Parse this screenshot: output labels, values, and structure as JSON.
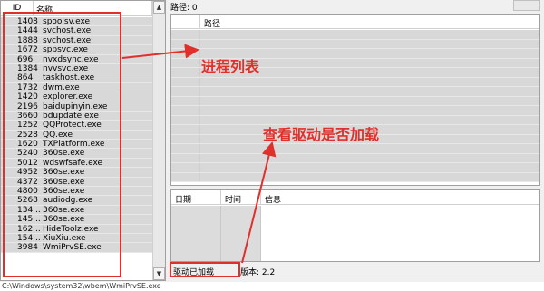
{
  "process_list": {
    "headers": {
      "pid": "ID",
      "name": "名称"
    },
    "rows": [
      {
        "pid": "1408",
        "name": "spoolsv.exe"
      },
      {
        "pid": "1444",
        "name": "svchost.exe"
      },
      {
        "pid": "1888",
        "name": "svchost.exe"
      },
      {
        "pid": "1672",
        "name": "sppsvc.exe"
      },
      {
        "pid": "696",
        "name": "nvxdsync.exe"
      },
      {
        "pid": "1384",
        "name": "nvvsvc.exe"
      },
      {
        "pid": "864",
        "name": "taskhost.exe"
      },
      {
        "pid": "1732",
        "name": "dwm.exe"
      },
      {
        "pid": "1420",
        "name": "explorer.exe"
      },
      {
        "pid": "2196",
        "name": "baidupinyin.exe"
      },
      {
        "pid": "3660",
        "name": "bdupdate.exe"
      },
      {
        "pid": "1252",
        "name": "QQProtect.exe"
      },
      {
        "pid": "2528",
        "name": "QQ.exe"
      },
      {
        "pid": "1620",
        "name": "TXPlatform.exe"
      },
      {
        "pid": "5240",
        "name": "360se.exe"
      },
      {
        "pid": "5012",
        "name": "wdswfsafe.exe"
      },
      {
        "pid": "4952",
        "name": "360se.exe"
      },
      {
        "pid": "4372",
        "name": "360se.exe"
      },
      {
        "pid": "4800",
        "name": "360se.exe"
      },
      {
        "pid": "5268",
        "name": "audiodg.exe"
      },
      {
        "pid": "134...",
        "name": "360se.exe"
      },
      {
        "pid": "145...",
        "name": "360se.exe"
      },
      {
        "pid": "162...",
        "name": "HideToolz.exe"
      },
      {
        "pid": "154...",
        "name": "XiuXiu.exe"
      },
      {
        "pid": "3984",
        "name": "WmiPrvSE.exe"
      }
    ],
    "scroll_up": "▲",
    "scroll_down": "▼"
  },
  "path_bar": {
    "label": "路径: 0"
  },
  "driver_panel": {
    "header": "路径"
  },
  "log_panel": {
    "headers": {
      "date": "日期",
      "time": "时间",
      "info": "信息"
    }
  },
  "status_bar": {
    "driver_status": "驱动已加载",
    "version": "版本: 2.2"
  },
  "bottom_path": "C:\\Windows\\system32\\wbem\\WmiPrvSE.exe",
  "annotations": {
    "process_list": "进程列表",
    "driver_check": "查看驱动是否加载"
  },
  "colors": {
    "highlight": "#e0302c",
    "row_bg": "#d8d8d8"
  }
}
